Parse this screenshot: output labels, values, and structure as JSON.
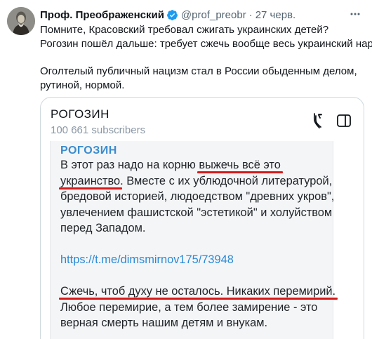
{
  "author": {
    "name": "Проф. Преображенский",
    "handle": "@prof_preobr",
    "separator": "·",
    "time": "27 черв."
  },
  "tweet": {
    "lines": [
      "Помните, Красовский требовал сжигать украинских детей?",
      "Рогозин пошёл дальше: требует сжечь вообще весь украинский народ.",
      "Оголтелый публичный нацизм стал в России обыденным делом,",
      "рутиной, нормой."
    ]
  },
  "card": {
    "title": "РОГОЗИН",
    "subscribers": "100 661 subscribers",
    "embed": {
      "channel": "РОГОЗИН",
      "line1_pre": "В этот раз надо на корню ",
      "line1_ul": "выжечь всё это",
      "line2_ul": "украинство",
      "line2_post": ". Вместе с их ублюдочной литературой,",
      "line3": "бредовой историей, людоедством \"древних укров\",",
      "line4": "увлечением фашистской \"эстетикой\" и холуйством",
      "line5": "перед Западом.",
      "link": "https://t.me/dimsmirnov175/73948",
      "line6_ul": "Сжечь, чтоб духу не осталось. Никаких перемирий.",
      "line7": "Любое перемирие, а тем более замирение - это",
      "line8": "верная смерть нашим детям и внукам."
    }
  },
  "colors": {
    "text": "#0f1419",
    "muted": "#536471",
    "verified": "#1d9bf0",
    "channel": "#3a8ccf",
    "link": "#2a8ad6",
    "underline": "#d71919"
  },
  "icons": [
    "verified-badge-icon",
    "more-options-icon",
    "feed-icon",
    "sidebar-panel-icon"
  ]
}
